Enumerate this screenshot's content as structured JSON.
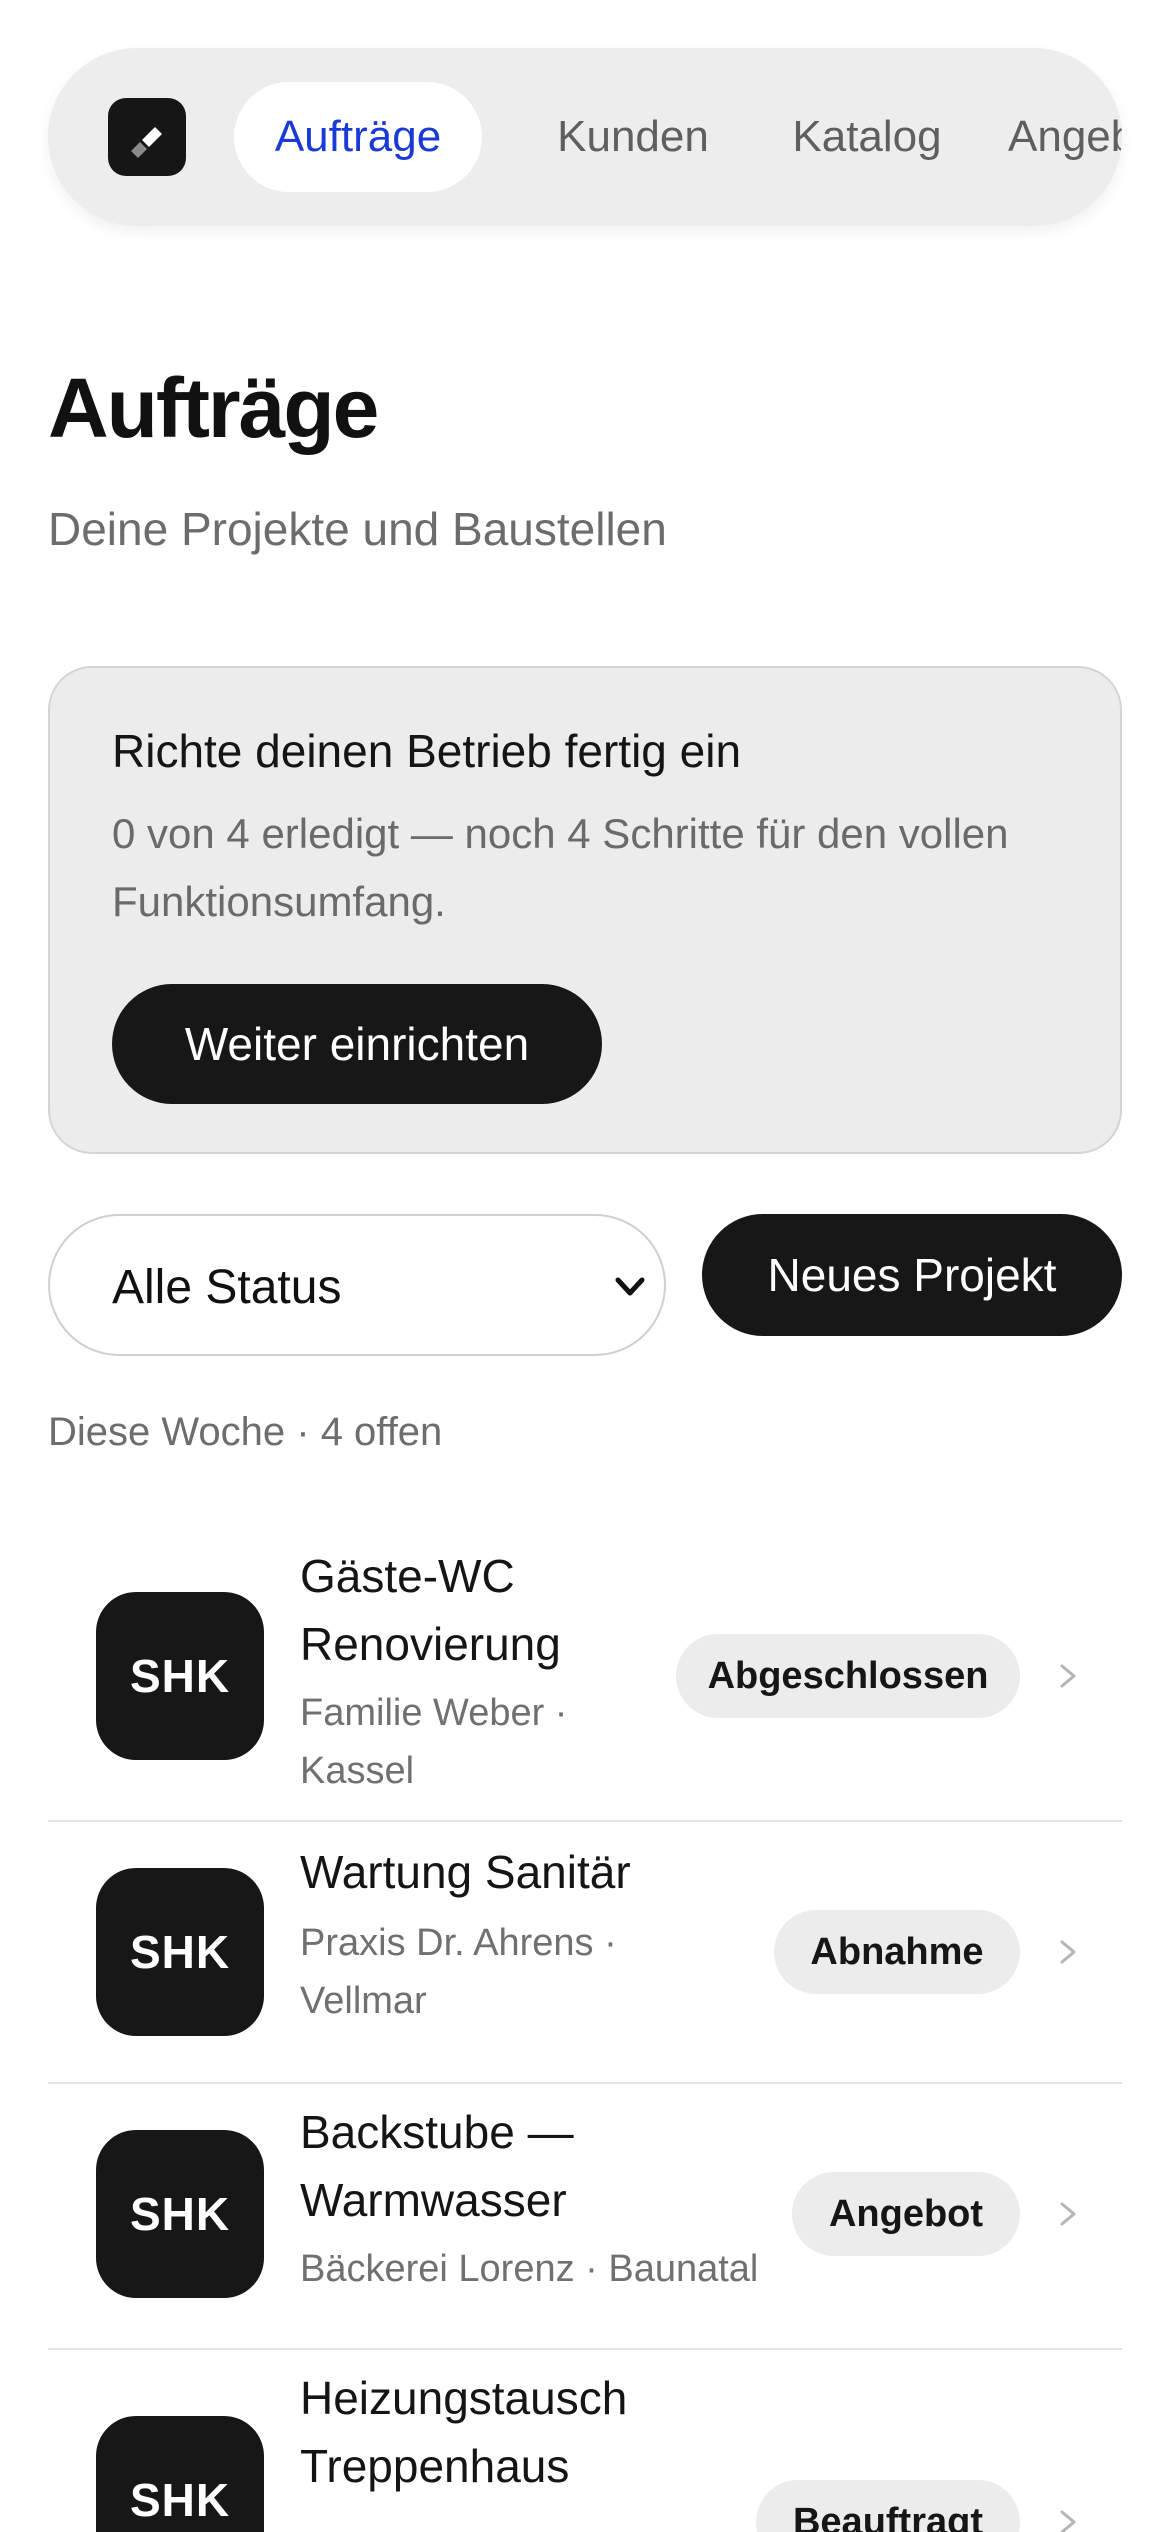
{
  "nav": {
    "logo_icon": "hammer-icon",
    "tabs": [
      {
        "label": "Aufträge",
        "active": true
      },
      {
        "label": "Kunden",
        "active": false
      },
      {
        "label": "Katalog",
        "active": false
      },
      {
        "label": "Angebote",
        "active": false
      }
    ],
    "accent_color": "#1a3ad6"
  },
  "page": {
    "title": "Aufträge",
    "subtitle": "Deine Projekte und Baustellen"
  },
  "setup": {
    "title": "Richte deinen Betrieb fertig ein",
    "text": "0 von 4 erledigt — noch 4 Schritte für den vollen Funktionsumfang.",
    "button_label": "Weiter einrichten"
  },
  "filters": {
    "status_selected": "Alle Status",
    "new_project_label": "Neues Projekt"
  },
  "summary": "Diese Woche · 4 offen",
  "projects": [
    {
      "avatar": "SHK",
      "title_line1": "Gäste-WC",
      "title_line2": "Renovierung",
      "sub_line1": "Familie Weber ·",
      "sub_line2": "Kassel",
      "status": "Abgeschlossen"
    },
    {
      "avatar": "SHK",
      "title_line1": "Wartung Sanitär",
      "sub_line1": "Praxis Dr. Ahrens ·",
      "sub_line2": "Vellmar",
      "status": "Abnahme"
    },
    {
      "avatar": "SHK",
      "title_line1": "Backstube —",
      "title_line2": "Warmwasser",
      "sub_line1": "Bäckerei Lorenz · Baunatal",
      "status": "Angebot"
    },
    {
      "avatar": "SHK",
      "title_line1": "Heizungstausch",
      "title_line2": "Treppenhaus",
      "status": "Beauftragt"
    }
  ]
}
